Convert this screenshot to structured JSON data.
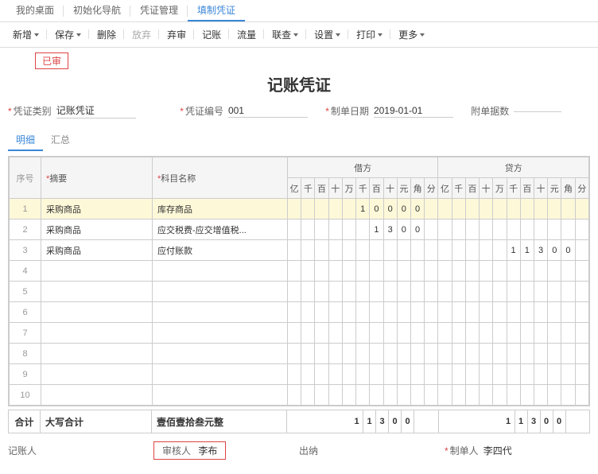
{
  "topTabs": {
    "t0": "我的桌面",
    "t1": "初始化导航",
    "t2": "凭证管理",
    "t3": "填制凭证"
  },
  "toolbar": {
    "add": "新增",
    "save": "保存",
    "del": "删除",
    "abandon": "放弃",
    "discard": "弃审",
    "post": "记账",
    "flow": "流量",
    "link": "联查",
    "settings": "设置",
    "print": "打印",
    "more": "更多"
  },
  "stamp": "已审",
  "title": "记账凭证",
  "form": {
    "typeLabel": "凭证类别",
    "typeValue": "记账凭证",
    "noLabel": "凭证编号",
    "noValue": "001",
    "dateLabel": "制单日期",
    "dateValue": "2019-01-01",
    "attachLabel": "附单据数"
  },
  "subTabs": {
    "detail": "明细",
    "summary": "汇总"
  },
  "headers": {
    "seq": "序号",
    "summary": "摘要",
    "subject": "科目名称",
    "debit": "借方",
    "credit": "贷方",
    "digits": [
      "亿",
      "千",
      "百",
      "十",
      "万",
      "千",
      "百",
      "十",
      "元",
      "角",
      "分"
    ]
  },
  "rows": [
    {
      "n": "1",
      "summary": "采购商品",
      "subject": "库存商品",
      "debit": [
        "",
        "",
        "",
        "",
        "",
        "1",
        "0",
        "0",
        "0",
        "0",
        ""
      ],
      "credit": [
        "",
        "",
        "",
        "",
        "",
        "",
        "",
        "",
        "",
        "",
        ""
      ]
    },
    {
      "n": "2",
      "summary": "采购商品",
      "subject": "应交税费-应交增值税...",
      "debit": [
        "",
        "",
        "",
        "",
        "",
        "",
        "1",
        "3",
        "0",
        "0",
        ""
      ],
      "credit": [
        "",
        "",
        "",
        "",
        "",
        "",
        "",
        "",
        "",
        "",
        ""
      ]
    },
    {
      "n": "3",
      "summary": "采购商品",
      "subject": "应付账款",
      "debit": [
        "",
        "",
        "",
        "",
        "",
        "",
        "",
        "",
        "",
        "",
        ""
      ],
      "credit": [
        "",
        "",
        "",
        "",
        "",
        "1",
        "1",
        "3",
        "0",
        "0",
        ""
      ]
    }
  ],
  "emptyRows": [
    "4",
    "5",
    "6",
    "7",
    "8",
    "9",
    "10"
  ],
  "totals": {
    "label": "合计",
    "capsLabel": "大写合计",
    "capsValue": "壹佰壹拾叁元整",
    "debit": [
      "",
      "",
      "",
      "",
      "",
      "1",
      "1",
      "3",
      "0",
      "0",
      ""
    ],
    "credit": [
      "",
      "",
      "",
      "",
      "",
      "1",
      "1",
      "3",
      "0",
      "0",
      ""
    ]
  },
  "signers": {
    "poster": "记账人",
    "auditorLabel": "审核人",
    "auditorValue": "李布",
    "cashier": "出纳",
    "creatorLabel": "制单人",
    "creatorValue": "李四代"
  }
}
